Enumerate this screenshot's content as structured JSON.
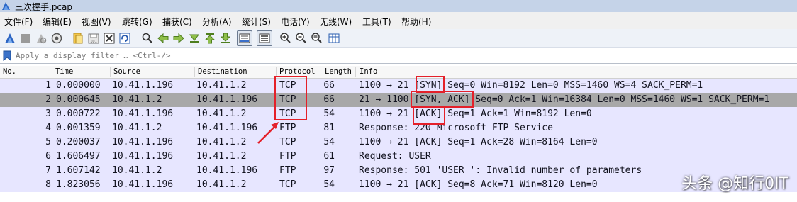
{
  "window": {
    "title": "三次握手.pcap"
  },
  "menu": [
    "文件(F)",
    "编辑(E)",
    "视图(V)",
    "跳转(G)",
    "捕获(C)",
    "分析(A)",
    "统计(S)",
    "电话(Y)",
    "无线(W)",
    "工具(T)",
    "帮助(H)"
  ],
  "toolbar": {
    "icons": [
      "start-capture-icon",
      "stop-capture-icon",
      "restart-capture-icon",
      "capture-options-icon",
      "open-file-icon",
      "save-file-icon",
      "close-file-icon",
      "reload-file-icon",
      "find-packet-icon",
      "go-back-icon",
      "go-forward-icon",
      "go-to-packet-icon",
      "go-first-packet-icon",
      "go-last-packet-icon",
      "autoscroll-icon",
      "colorize-icon",
      "zoom-in-icon",
      "zoom-out-icon",
      "zoom-normal-icon",
      "resize-columns-icon"
    ]
  },
  "filter": {
    "placeholder": "Apply a display filter … <Ctrl-/>"
  },
  "columns": {
    "no": "No.",
    "time": "Time",
    "source": "Source",
    "destination": "Destination",
    "protocol": "Protocol",
    "length": "Length",
    "info": "Info"
  },
  "packets": [
    {
      "no": "1",
      "time": "0.000000",
      "source": "10.41.1.196",
      "destination": "10.41.1.2",
      "protocol": "TCP",
      "length": "66",
      "info": "1100 → 21 [SYN] Seq=0 Win=8192 Len=0 MSS=1460 WS=4 SACK_PERM=1"
    },
    {
      "no": "2",
      "time": "0.000645",
      "source": "10.41.1.2",
      "destination": "10.41.1.196",
      "protocol": "TCP",
      "length": "66",
      "info": "21 → 1100 [SYN, ACK] Seq=0 Ack=1 Win=16384 Len=0 MSS=1460 WS=1 SACK_PERM=1"
    },
    {
      "no": "3",
      "time": "0.000722",
      "source": "10.41.1.196",
      "destination": "10.41.1.2",
      "protocol": "TCP",
      "length": "54",
      "info": "1100 → 21 [ACK] Seq=1 Ack=1 Win=8192 Len=0"
    },
    {
      "no": "4",
      "time": "0.001359",
      "source": "10.41.1.2",
      "destination": "10.41.1.196",
      "protocol": "FTP",
      "length": "81",
      "info": "Response: 220 Microsoft FTP Service"
    },
    {
      "no": "5",
      "time": "0.200037",
      "source": "10.41.1.196",
      "destination": "10.41.1.2",
      "protocol": "TCP",
      "length": "54",
      "info": "1100 → 21 [ACK] Seq=1 Ack=28 Win=8164 Len=0"
    },
    {
      "no": "6",
      "time": "1.606497",
      "source": "10.41.1.196",
      "destination": "10.41.1.2",
      "protocol": "FTP",
      "length": "61",
      "info": "Request: USER"
    },
    {
      "no": "7",
      "time": "1.607142",
      "source": "10.41.1.2",
      "destination": "10.41.1.196",
      "protocol": "FTP",
      "length": "97",
      "info": "Response: 501 'USER ': Invalid number of parameters"
    },
    {
      "no": "8",
      "time": "1.823056",
      "source": "10.41.1.196",
      "destination": "10.41.1.2",
      "protocol": "TCP",
      "length": "54",
      "info": "1100 → 21 [ACK] Seq=8 Ack=71 Win=8120 Len=0"
    }
  ],
  "selected_row": "2",
  "colors": {
    "row_bg": "#e7e6ff",
    "row_selected_bg": "#a8a8a8",
    "annotation": "#e4202a",
    "titlebar": "#c5d3e8"
  },
  "watermark": "头条 @知行0IT"
}
